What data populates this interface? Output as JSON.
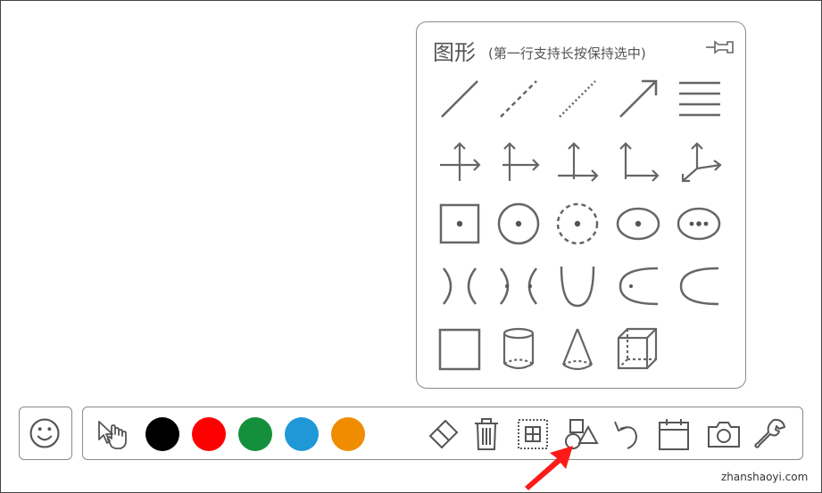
{
  "panel": {
    "title": "图形",
    "subtitle": "(第一行支持长按保持选中)",
    "rows": [
      [
        "line-icon",
        "dashed-line-icon",
        "dotted-line-icon",
        "arrow-line-icon",
        "parallel-lines-icon"
      ],
      [
        "axis-2d-both-icon",
        "axis-2d-right-icon",
        "axis-2d-up-right-icon",
        "axis-2d-quadrant-icon",
        "axis-3d-icon"
      ],
      [
        "square-with-dot-icon",
        "circle-with-dot-icon",
        "dashed-circle-with-dot-icon",
        "ellipse-with-dot-icon",
        "ellipse-with-two-dots-icon"
      ],
      [
        "hyperbola-icon",
        "hyperbola-with-foci-icon",
        "parabola-up-icon",
        "parabola-left-with-focus-icon",
        "parabola-left-icon"
      ],
      [
        "square-icon",
        "cylinder-icon",
        "cone-icon",
        "cube-icon"
      ]
    ]
  },
  "toolbar": {
    "colors": [
      "#000000",
      "#ff0000",
      "#14903c",
      "#2098d8",
      "#f08c00"
    ],
    "tools": [
      "eraser-icon",
      "trash-icon",
      "grid-select-icon",
      "shapes-icon",
      "undo-icon",
      "calendar-icon",
      "camera-icon",
      "wrench-icon"
    ]
  },
  "watermark": "zhanshaoyi.com"
}
